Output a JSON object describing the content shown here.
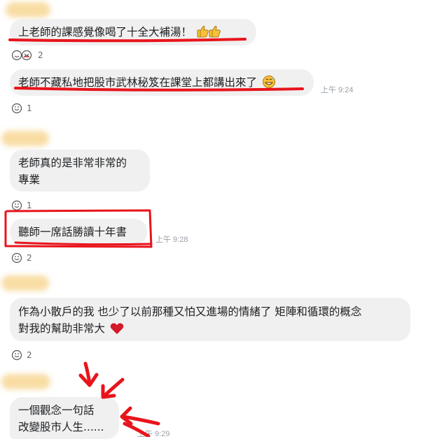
{
  "messages": [
    {
      "text": "上老師的課感覺像喝了十全大補湯！",
      "emoji": "thumbs-up-x2",
      "reaction_count": "2"
    },
    {
      "text": "老師不藏私地把股市武林秘笈在課堂上都講出來了",
      "emoji": "grinning-sweat",
      "time": "上午 9:24",
      "reaction_count": "1"
    },
    {
      "line1": "老師真的是非常非常的",
      "line2": "專業",
      "reaction_count": "1"
    },
    {
      "text": "聽師一席話勝讀十年書",
      "time": "上午 9:28",
      "reaction_count": "2"
    },
    {
      "line1": "作為小散戶的我 也少了以前那種又怕又進場的情緒了 矩陣和循環的概念",
      "line2": "對我的幫助非常大",
      "emoji": "heart",
      "reaction_count": "2"
    },
    {
      "line1": "一個觀念一句話",
      "line2": "改變股市人生......",
      "time": "上午 9:29"
    }
  ],
  "colors": {
    "bubble": "#f0f0f0",
    "annotation_red": "#e8141c",
    "name_blur": "#f8d99a",
    "timestamp": "#9aa0a6"
  }
}
